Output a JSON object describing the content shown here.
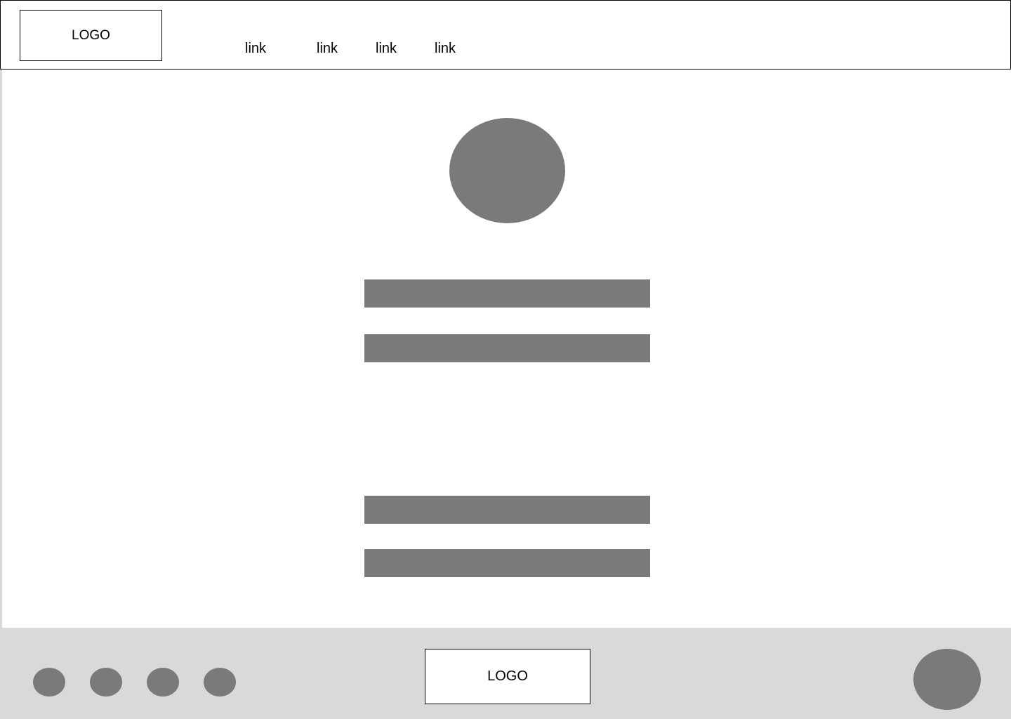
{
  "header": {
    "logo": "LOGO",
    "nav": [
      {
        "label": "link"
      },
      {
        "label": "link"
      },
      {
        "label": "link"
      },
      {
        "label": "link"
      }
    ]
  },
  "footer": {
    "logo": "LOGO"
  },
  "colors": {
    "placeholder_fill": "#7a7a7a",
    "footer_background": "#d9d9d9",
    "border": "#000000",
    "background": "#ffffff"
  }
}
